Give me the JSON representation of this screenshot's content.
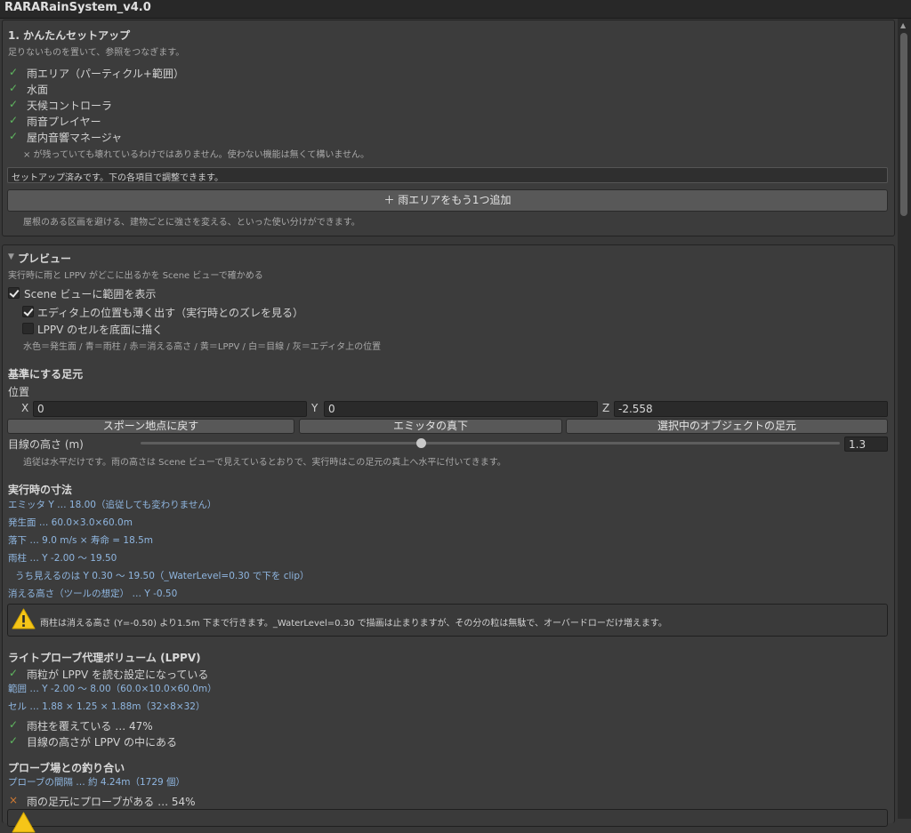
{
  "window": {
    "title": "RARARainSystem_v4.0"
  },
  "setup": {
    "heading": "1. かんたんセットアップ",
    "subtitle": "足りないものを置いて、参照をつなぎます。",
    "items": [
      {
        "label": "雨エリア（パーティクル+範囲）",
        "state": "ok"
      },
      {
        "label": "水面",
        "state": "ok"
      },
      {
        "label": "天候コントローラ",
        "state": "ok"
      },
      {
        "label": "雨音プレイヤー",
        "state": "ok"
      },
      {
        "label": "屋内音響マネージャ",
        "state": "ok"
      }
    ],
    "note": "× が残っていても壊れているわけではありません。使わない機能は無くて構いません。",
    "status": "セットアップ済みです。下の各項目で調整できます。",
    "add_button": "＋ 雨エリアをもう1つ追加",
    "add_hint": "屋根のある区画を避ける、建物ごとに強さを変える、といった使い分けができます。"
  },
  "preview": {
    "heading": "プレビュー",
    "subtitle": "実行時に雨と LPPV がどこに出るかを Scene ビューで確かめる",
    "show_range": {
      "label": "Scene ビューに範囲を表示",
      "checked": true
    },
    "show_editor_pos": {
      "label": "エディタ上の位置も薄く出す（実行時とのズレを見る）",
      "checked": true
    },
    "draw_lppv": {
      "label": "LPPV のセルを底面に描く",
      "checked": false
    },
    "legend": "水色＝発生面 / 青＝雨柱 / 赤＝消える高さ / 黄＝LPPV / 白＝目線 / 灰＝エディタ上の位置"
  },
  "foot": {
    "heading": "基準にする足元",
    "position_label": "位置",
    "x_label": "X",
    "x_value": "0",
    "y_label": "Y",
    "y_value": "0",
    "z_label": "Z",
    "z_value": "-2.558",
    "btn_spawn": "スポーン地点に戻す",
    "btn_emitter": "エミッタの真下",
    "btn_selected": "選択中のオブジェクトの足元",
    "eye_label": "目線の高さ (m)",
    "eye_value": "1.3",
    "eye_fraction": 0.4,
    "hint": "追従は水平だけです。雨の高さは Scene ビューで見えているとおりで、実行時はこの足元の真上へ水平に付いてきます。"
  },
  "runtime": {
    "heading": "実行時の寸法",
    "lines": [
      "エミッタ Y … 18.00（追従しても変わりません）",
      "発生面 … 60.0×3.0×60.0m",
      "落下 … 9.0 m/s × 寿命 = 18.5m",
      "雨柱 … Y -2.00 〜 19.50",
      "うち見えるのは Y 0.30 〜 19.50（_WaterLevel=0.30 で下を clip）",
      "消える高さ（ツールの想定） … Y -0.50"
    ],
    "warning": "雨柱は消える高さ (Y=-0.50) より1.5m 下まで行きます。_WaterLevel=0.30 で描画は止まりますが、その分の粒は無駄で、オーバードローだけ増えます。"
  },
  "lppv": {
    "heading": "ライトプローブ代理ボリューム (LPPV)",
    "check1": "雨粒が LPPV を読む設定になっている",
    "range": "範囲 … Y -2.00 〜 8.00（60.0×10.0×60.0m）",
    "cell": "セル … 1.88 × 1.25 × 1.88m（32×8×32）",
    "check2": "雨柱を覆えている … 47%",
    "check3": "目線の高さが LPPV の中にある"
  },
  "probe": {
    "heading": "プローブ場との釣り合い",
    "spacing": "プローブの間隔 … 約 4.24m（1729 個）",
    "coverage": "雨の足元にプローブがある … 54%"
  },
  "colors": {
    "check": "#5fb860",
    "cross": "#d07a33",
    "info": "#8fb6e0",
    "warning": "#f5c518"
  }
}
